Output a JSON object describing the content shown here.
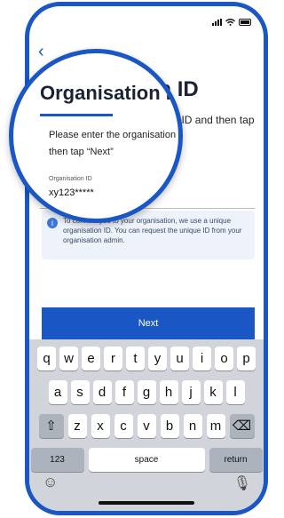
{
  "screen": {
    "back_icon": "chevron-left-icon",
    "title": "Organisation ID",
    "intro": "Please enter the organisation ID and then tap “Next”"
  },
  "field": {
    "label": "Organisation ID",
    "value": "xy123*****"
  },
  "info": {
    "icon": "info-icon",
    "text": "To connect you to your organisation, we use a unique organisation ID. You can request the unique ID from your organisation admin."
  },
  "next_button": "Next",
  "keyboard": {
    "row1": [
      "q",
      "w",
      "e",
      "r",
      "t",
      "y",
      "u",
      "i",
      "o",
      "p"
    ],
    "row2": [
      "a",
      "s",
      "d",
      "f",
      "g",
      "h",
      "j",
      "k",
      "l"
    ],
    "row3": [
      "z",
      "x",
      "c",
      "v",
      "b",
      "n",
      "m"
    ],
    "numbers_key": "123",
    "space_key": "space",
    "return_key": "return"
  },
  "colors": {
    "accent": "#1a56c4",
    "info_bg": "#eef3fb"
  }
}
